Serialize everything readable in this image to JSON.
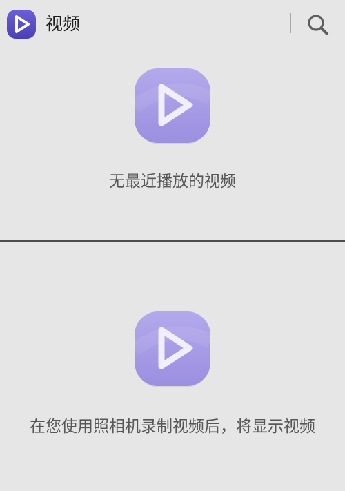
{
  "app_bar": {
    "title": "视频",
    "app_icon": "video-play-icon",
    "search_icon": "search-icon"
  },
  "empty_recent": {
    "icon": "video-play-icon",
    "message": "无最近播放的视频"
  },
  "empty_camera": {
    "icon": "video-play-icon",
    "message": "在您使用照相机录制视频后，将显示视频"
  },
  "colors": {
    "background": "#e6e6e6",
    "app_icon_purple": "#5a4fc8",
    "placeholder_purple": "#a79ce6",
    "divider": "#4d4d4d"
  }
}
